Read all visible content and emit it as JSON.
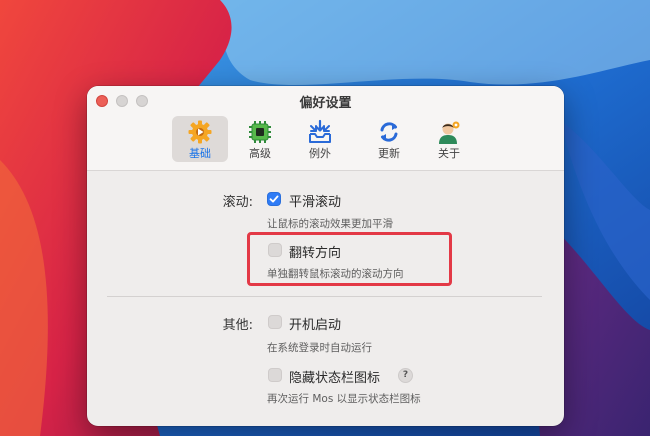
{
  "window": {
    "title": "偏好设置"
  },
  "toolbar": {
    "tabs": [
      {
        "label": "基础",
        "icon": "gear-icon",
        "active": true
      },
      {
        "label": "高级",
        "icon": "chip-icon",
        "active": false
      },
      {
        "label": "例外",
        "icon": "tray-arrows-icon",
        "active": false
      },
      {
        "label": "更新",
        "icon": "refresh-icon",
        "active": false
      },
      {
        "label": "关于",
        "icon": "user-icon",
        "active": false
      }
    ]
  },
  "scroll_section": {
    "label": "滚动:",
    "smooth": {
      "label": "平滑滚动",
      "desc": "让鼠标的滚动效果更加平滑",
      "checked": true
    },
    "reverse": {
      "label": "翻转方向",
      "desc": "单独翻转鼠标滚动的滚动方向",
      "checked": false
    }
  },
  "other_section": {
    "label": "其他:",
    "launch": {
      "label": "开机启动",
      "desc": "在系统登录时自动运行",
      "checked": false
    },
    "hide_icon": {
      "label": "隐藏状态栏图标",
      "desc": "再次运行 Mos 以显示状态栏图标",
      "checked": false,
      "help": "?"
    }
  },
  "colors": {
    "accent": "#2f7cf6",
    "highlight": "#e33946"
  }
}
